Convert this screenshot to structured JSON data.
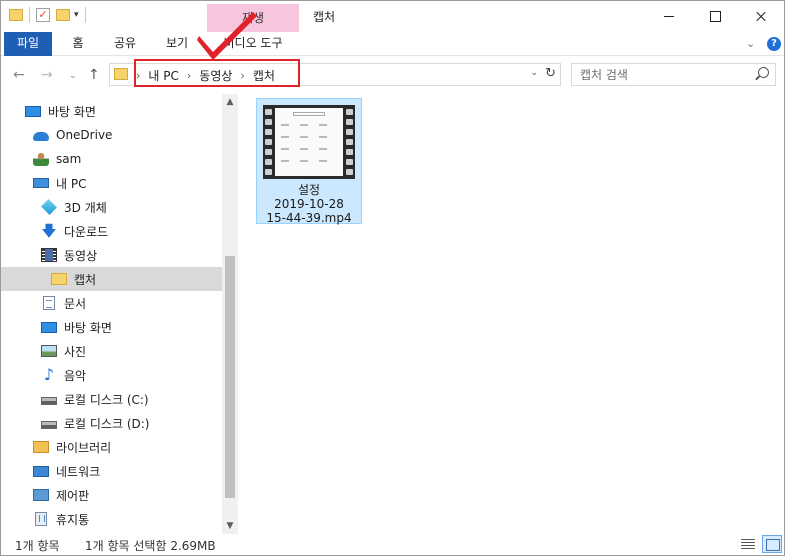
{
  "window": {
    "title": "캡처",
    "context_tab_group": "재생",
    "context_tab_color": "#f7c6de"
  },
  "quick_access": {
    "icons": [
      "folder-icon",
      "properties-check-icon",
      "new-folder-icon",
      "customize-dropdown-icon"
    ]
  },
  "caption_buttons": [
    "minimize",
    "maximize",
    "close"
  ],
  "ribbon": {
    "tabs": [
      {
        "id": "file",
        "label": "파일",
        "active": true
      },
      {
        "id": "home",
        "label": "홈"
      },
      {
        "id": "share",
        "label": "공유"
      },
      {
        "id": "view",
        "label": "보기"
      },
      {
        "id": "video_tools",
        "label": "비디오 도구"
      }
    ],
    "collapse_icon": "chevron-down-icon",
    "help_label": "?"
  },
  "navigation": {
    "back": "←",
    "forward": "→",
    "recent": "⌄",
    "up": "↑"
  },
  "address": {
    "breadcrumbs": [
      "내 PC",
      "동영상",
      "캡처"
    ],
    "separator": "›",
    "refresh": "↻",
    "highlight_color": "#e0232b"
  },
  "search": {
    "placeholder": "캡처 검색"
  },
  "sidebar": {
    "items": [
      {
        "label": "바탕 화면",
        "icon": "desktop-icon",
        "level": 0
      },
      {
        "label": "OneDrive",
        "icon": "onedrive-icon",
        "level": 1
      },
      {
        "label": "sam",
        "icon": "user-icon",
        "level": 1
      },
      {
        "label": "내 PC",
        "icon": "pc-icon",
        "level": 1
      },
      {
        "label": "3D 개체",
        "icon": "3d-objects-icon",
        "level": 2
      },
      {
        "label": "다운로드",
        "icon": "download-icon",
        "level": 2
      },
      {
        "label": "동영상",
        "icon": "video-icon",
        "level": 2
      },
      {
        "label": "캡처",
        "icon": "folder-icon",
        "level": 3,
        "selected": true
      },
      {
        "label": "문서",
        "icon": "document-icon",
        "level": 2
      },
      {
        "label": "바탕 화면",
        "icon": "desktop-icon",
        "level": 2
      },
      {
        "label": "사진",
        "icon": "pictures-icon",
        "level": 2
      },
      {
        "label": "음악",
        "icon": "music-icon",
        "level": 2
      },
      {
        "label": "로컬 디스크 (C:)",
        "icon": "drive-icon",
        "level": 2
      },
      {
        "label": "로컬 디스크 (D:)",
        "icon": "drive-icon",
        "level": 2
      },
      {
        "label": "라이브러리",
        "icon": "library-icon",
        "level": 1
      },
      {
        "label": "네트워크",
        "icon": "network-icon",
        "level": 1
      },
      {
        "label": "제어판",
        "icon": "control-panel-icon",
        "level": 1
      },
      {
        "label": "휴지통",
        "icon": "recycle-bin-icon",
        "level": 1
      }
    ]
  },
  "files": [
    {
      "name_lines": [
        "설정",
        "2019-10-28",
        "15-44-39.mp4"
      ],
      "type": "video",
      "selected": true
    }
  ],
  "status": {
    "item_count": "1개 항목",
    "selection": "1개 항목 선택함 2.69MB"
  },
  "view_modes": [
    "details-view-icon",
    "large-icons-view-icon"
  ]
}
